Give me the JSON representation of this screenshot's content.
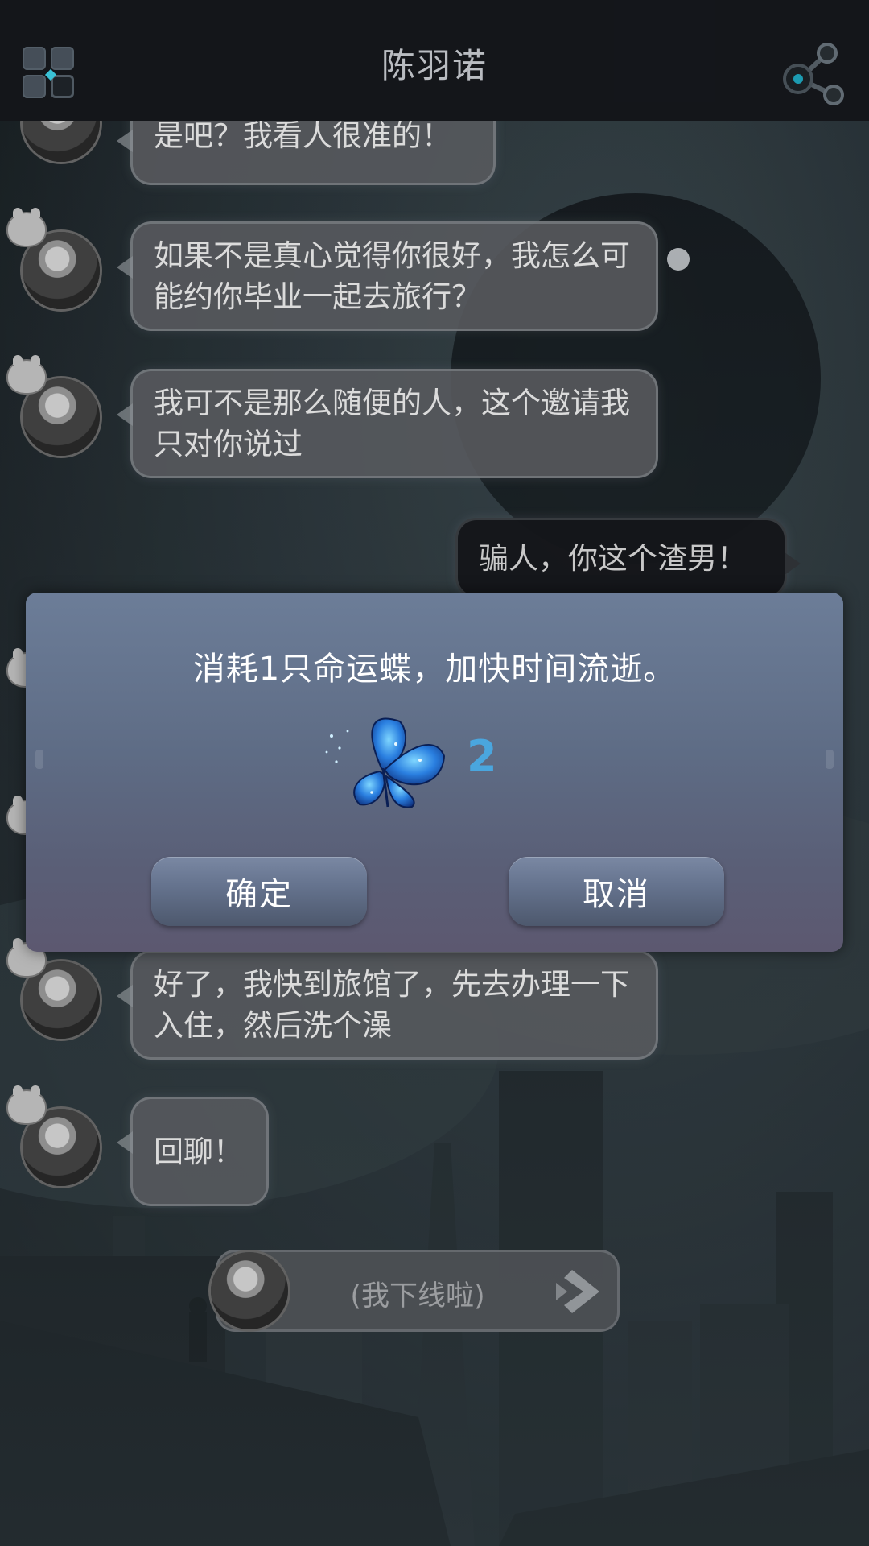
{
  "header": {
    "title": "陈羽诺",
    "menu_icon": "grid-menu-icon",
    "share_icon": "share-icon"
  },
  "chat": {
    "messages": [
      {
        "from": "other",
        "text": "是吧？我看人很准的！"
      },
      {
        "from": "other",
        "text": "如果不是真心觉得你很好，我怎么可能约你毕业一起去旅行？"
      },
      {
        "from": "other",
        "text": "我可不是那么随便的人，这个邀请我只对你说过"
      },
      {
        "from": "me",
        "text": "骗人，你这个渣男！"
      },
      {
        "from": "other",
        "text": "好了，我快到旅馆了，先去办理一下入住，然后洗个澡"
      },
      {
        "from": "other",
        "text": "回聊！"
      }
    ],
    "offline_text": "(我下线啦)",
    "offline_icon": "next-arrow-icon"
  },
  "dialog": {
    "message": "消耗1只命运蝶，加快时间流逝。",
    "item_icon": "blue-butterfly-icon",
    "count": "2",
    "confirm_label": "确定",
    "cancel_label": "取消",
    "count_color": "#4aa6de"
  }
}
